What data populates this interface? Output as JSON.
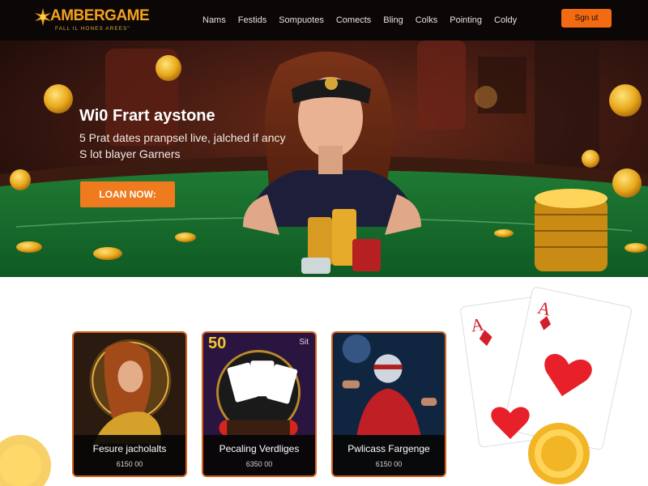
{
  "brand": {
    "name": "AMBERGAME",
    "tagline": "FALL IL HONES AREES\""
  },
  "nav": {
    "items": [
      "Nams",
      "Festids",
      "Sompuotes",
      "Comects",
      "Bling",
      "Colks",
      "Pointing",
      "Coldy"
    ],
    "sign_in": "Sgn ut"
  },
  "hero": {
    "title": "Wi0 Frart aystone",
    "subtitle": "5 Prat dates pranpsel live, jalched if ancy S lot blayer Garners",
    "cta": "LOAN NOW:"
  },
  "cards": [
    {
      "title": "Fesure jacholalts",
      "price": "6150 00"
    },
    {
      "title": "Pecaling Verdliges",
      "price": "6350 00"
    },
    {
      "title": "Pwlicass Fargenge",
      "price": "6150 00"
    }
  ],
  "card_badges": {
    "left": "50",
    "right": "Sit"
  },
  "colors": {
    "accent": "#f07a1e",
    "nav_bg": "#0a0706",
    "card_border": "#d4621a",
    "brand": "#f5a11b"
  }
}
